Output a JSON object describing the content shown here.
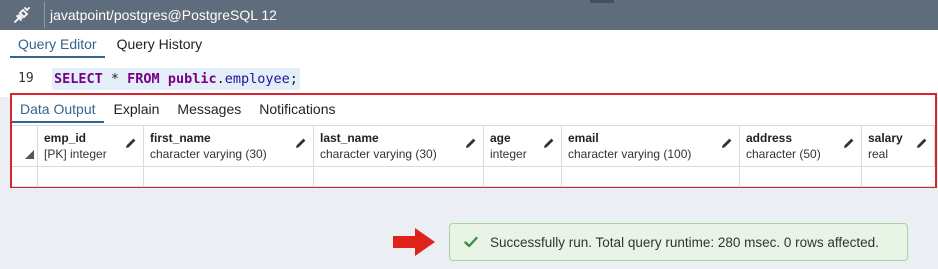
{
  "window": {
    "title": "javatpoint/postgres@PostgreSQL 12",
    "icon": "plug-icon"
  },
  "query_tabs": [
    {
      "label": "Query Editor",
      "active": true
    },
    {
      "label": "Query History",
      "active": false
    }
  ],
  "editor": {
    "line_number": "19",
    "tokens": {
      "kw_select": "SELECT",
      "star": " * ",
      "kw_from": "FROM",
      "space": " ",
      "schema": "public",
      "dot": ".",
      "table": "employee",
      "semicolon": ";"
    }
  },
  "output_tabs": [
    {
      "label": "Data Output",
      "active": true
    },
    {
      "label": "Explain",
      "active": false
    },
    {
      "label": "Messages",
      "active": false
    },
    {
      "label": "Notifications",
      "active": false
    }
  ],
  "columns": [
    {
      "name": "emp_id",
      "type": "[PK] integer"
    },
    {
      "name": "first_name",
      "type": "character varying (30)"
    },
    {
      "name": "last_name",
      "type": "character varying (30)"
    },
    {
      "name": "age",
      "type": "integer"
    },
    {
      "name": "email",
      "type": "character varying (100)"
    },
    {
      "name": "address",
      "type": "character (50)"
    },
    {
      "name": "salary",
      "type": "real"
    }
  ],
  "status": {
    "message": "Successfully run. Total query runtime: 280 msec. 0 rows affected.",
    "icon": "check-icon"
  },
  "colors": {
    "accent": "#326690",
    "highlight_border": "#d8242c",
    "success_bg": "#e8f5e6",
    "success_icon": "#3c8d3f",
    "arrow": "#e0221d"
  }
}
